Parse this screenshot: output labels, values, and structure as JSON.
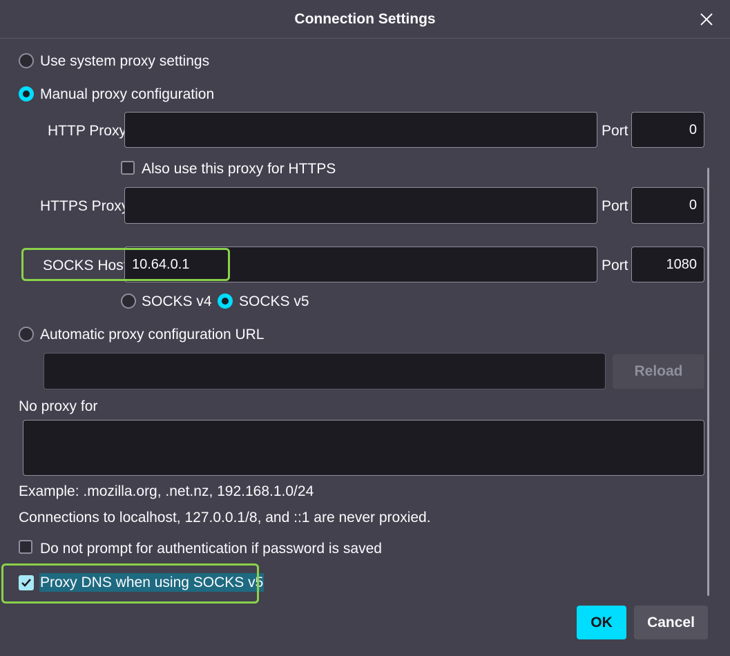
{
  "window": {
    "title": "Connection Settings",
    "close_icon": "close-icon"
  },
  "proxy_modes": {
    "system": {
      "label": "Use system proxy settings",
      "checked": false
    },
    "manual": {
      "label": "Manual proxy configuration",
      "checked": true
    },
    "auto": {
      "label": "Automatic proxy configuration URL",
      "checked": false
    }
  },
  "http": {
    "label": "HTTP Proxy",
    "value": "",
    "port_label": "Port",
    "port": "0"
  },
  "https_also": {
    "label": "Also use this proxy for HTTPS",
    "checked": false
  },
  "https": {
    "label": "HTTPS Proxy",
    "value": "",
    "port_label": "Port",
    "port": "0"
  },
  "socks": {
    "label": "SOCKS Host",
    "value": "10.64.0.1",
    "port_label": "Port",
    "port": "1080"
  },
  "socks_version": {
    "v4": {
      "label": "SOCKS v4",
      "checked": false
    },
    "v5": {
      "label": "SOCKS v5",
      "checked": true
    }
  },
  "auto_url": {
    "value": "",
    "reload_label": "Reload"
  },
  "no_proxy": {
    "label": "No proxy for",
    "value": "",
    "example": "Example: .mozilla.org, .net.nz, 192.168.1.0/24",
    "note": "Connections to localhost, 127.0.0.1/8, and ::1 are never proxied."
  },
  "options": {
    "no_auth_prompt": {
      "label": "Do not prompt for authentication if password is saved",
      "checked": false
    },
    "proxy_dns": {
      "label": "Proxy DNS when using SOCKS v5",
      "checked": true
    }
  },
  "buttons": {
    "ok": "OK",
    "cancel": "Cancel"
  },
  "colors": {
    "background": "#42414d",
    "accent": "#00ddff",
    "field": "#1c1b22",
    "highlight": "#8bd14a"
  }
}
